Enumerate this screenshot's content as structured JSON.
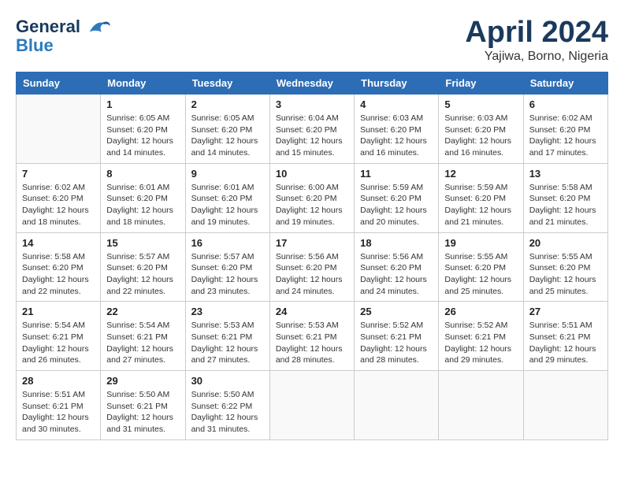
{
  "header": {
    "logo_line1": "General",
    "logo_line2": "Blue",
    "month": "April 2024",
    "location": "Yajiwa, Borno, Nigeria"
  },
  "weekdays": [
    "Sunday",
    "Monday",
    "Tuesday",
    "Wednesday",
    "Thursday",
    "Friday",
    "Saturday"
  ],
  "weeks": [
    [
      {
        "day": "",
        "info": ""
      },
      {
        "day": "1",
        "info": "Sunrise: 6:05 AM\nSunset: 6:20 PM\nDaylight: 12 hours\nand 14 minutes."
      },
      {
        "day": "2",
        "info": "Sunrise: 6:05 AM\nSunset: 6:20 PM\nDaylight: 12 hours\nand 14 minutes."
      },
      {
        "day": "3",
        "info": "Sunrise: 6:04 AM\nSunset: 6:20 PM\nDaylight: 12 hours\nand 15 minutes."
      },
      {
        "day": "4",
        "info": "Sunrise: 6:03 AM\nSunset: 6:20 PM\nDaylight: 12 hours\nand 16 minutes."
      },
      {
        "day": "5",
        "info": "Sunrise: 6:03 AM\nSunset: 6:20 PM\nDaylight: 12 hours\nand 16 minutes."
      },
      {
        "day": "6",
        "info": "Sunrise: 6:02 AM\nSunset: 6:20 PM\nDaylight: 12 hours\nand 17 minutes."
      }
    ],
    [
      {
        "day": "7",
        "info": "Sunrise: 6:02 AM\nSunset: 6:20 PM\nDaylight: 12 hours\nand 18 minutes."
      },
      {
        "day": "8",
        "info": "Sunrise: 6:01 AM\nSunset: 6:20 PM\nDaylight: 12 hours\nand 18 minutes."
      },
      {
        "day": "9",
        "info": "Sunrise: 6:01 AM\nSunset: 6:20 PM\nDaylight: 12 hours\nand 19 minutes."
      },
      {
        "day": "10",
        "info": "Sunrise: 6:00 AM\nSunset: 6:20 PM\nDaylight: 12 hours\nand 19 minutes."
      },
      {
        "day": "11",
        "info": "Sunrise: 5:59 AM\nSunset: 6:20 PM\nDaylight: 12 hours\nand 20 minutes."
      },
      {
        "day": "12",
        "info": "Sunrise: 5:59 AM\nSunset: 6:20 PM\nDaylight: 12 hours\nand 21 minutes."
      },
      {
        "day": "13",
        "info": "Sunrise: 5:58 AM\nSunset: 6:20 PM\nDaylight: 12 hours\nand 21 minutes."
      }
    ],
    [
      {
        "day": "14",
        "info": "Sunrise: 5:58 AM\nSunset: 6:20 PM\nDaylight: 12 hours\nand 22 minutes."
      },
      {
        "day": "15",
        "info": "Sunrise: 5:57 AM\nSunset: 6:20 PM\nDaylight: 12 hours\nand 22 minutes."
      },
      {
        "day": "16",
        "info": "Sunrise: 5:57 AM\nSunset: 6:20 PM\nDaylight: 12 hours\nand 23 minutes."
      },
      {
        "day": "17",
        "info": "Sunrise: 5:56 AM\nSunset: 6:20 PM\nDaylight: 12 hours\nand 24 minutes."
      },
      {
        "day": "18",
        "info": "Sunrise: 5:56 AM\nSunset: 6:20 PM\nDaylight: 12 hours\nand 24 minutes."
      },
      {
        "day": "19",
        "info": "Sunrise: 5:55 AM\nSunset: 6:20 PM\nDaylight: 12 hours\nand 25 minutes."
      },
      {
        "day": "20",
        "info": "Sunrise: 5:55 AM\nSunset: 6:20 PM\nDaylight: 12 hours\nand 25 minutes."
      }
    ],
    [
      {
        "day": "21",
        "info": "Sunrise: 5:54 AM\nSunset: 6:21 PM\nDaylight: 12 hours\nand 26 minutes."
      },
      {
        "day": "22",
        "info": "Sunrise: 5:54 AM\nSunset: 6:21 PM\nDaylight: 12 hours\nand 27 minutes."
      },
      {
        "day": "23",
        "info": "Sunrise: 5:53 AM\nSunset: 6:21 PM\nDaylight: 12 hours\nand 27 minutes."
      },
      {
        "day": "24",
        "info": "Sunrise: 5:53 AM\nSunset: 6:21 PM\nDaylight: 12 hours\nand 28 minutes."
      },
      {
        "day": "25",
        "info": "Sunrise: 5:52 AM\nSunset: 6:21 PM\nDaylight: 12 hours\nand 28 minutes."
      },
      {
        "day": "26",
        "info": "Sunrise: 5:52 AM\nSunset: 6:21 PM\nDaylight: 12 hours\nand 29 minutes."
      },
      {
        "day": "27",
        "info": "Sunrise: 5:51 AM\nSunset: 6:21 PM\nDaylight: 12 hours\nand 29 minutes."
      }
    ],
    [
      {
        "day": "28",
        "info": "Sunrise: 5:51 AM\nSunset: 6:21 PM\nDaylight: 12 hours\nand 30 minutes."
      },
      {
        "day": "29",
        "info": "Sunrise: 5:50 AM\nSunset: 6:21 PM\nDaylight: 12 hours\nand 31 minutes."
      },
      {
        "day": "30",
        "info": "Sunrise: 5:50 AM\nSunset: 6:22 PM\nDaylight: 12 hours\nand 31 minutes."
      },
      {
        "day": "",
        "info": ""
      },
      {
        "day": "",
        "info": ""
      },
      {
        "day": "",
        "info": ""
      },
      {
        "day": "",
        "info": ""
      }
    ]
  ]
}
